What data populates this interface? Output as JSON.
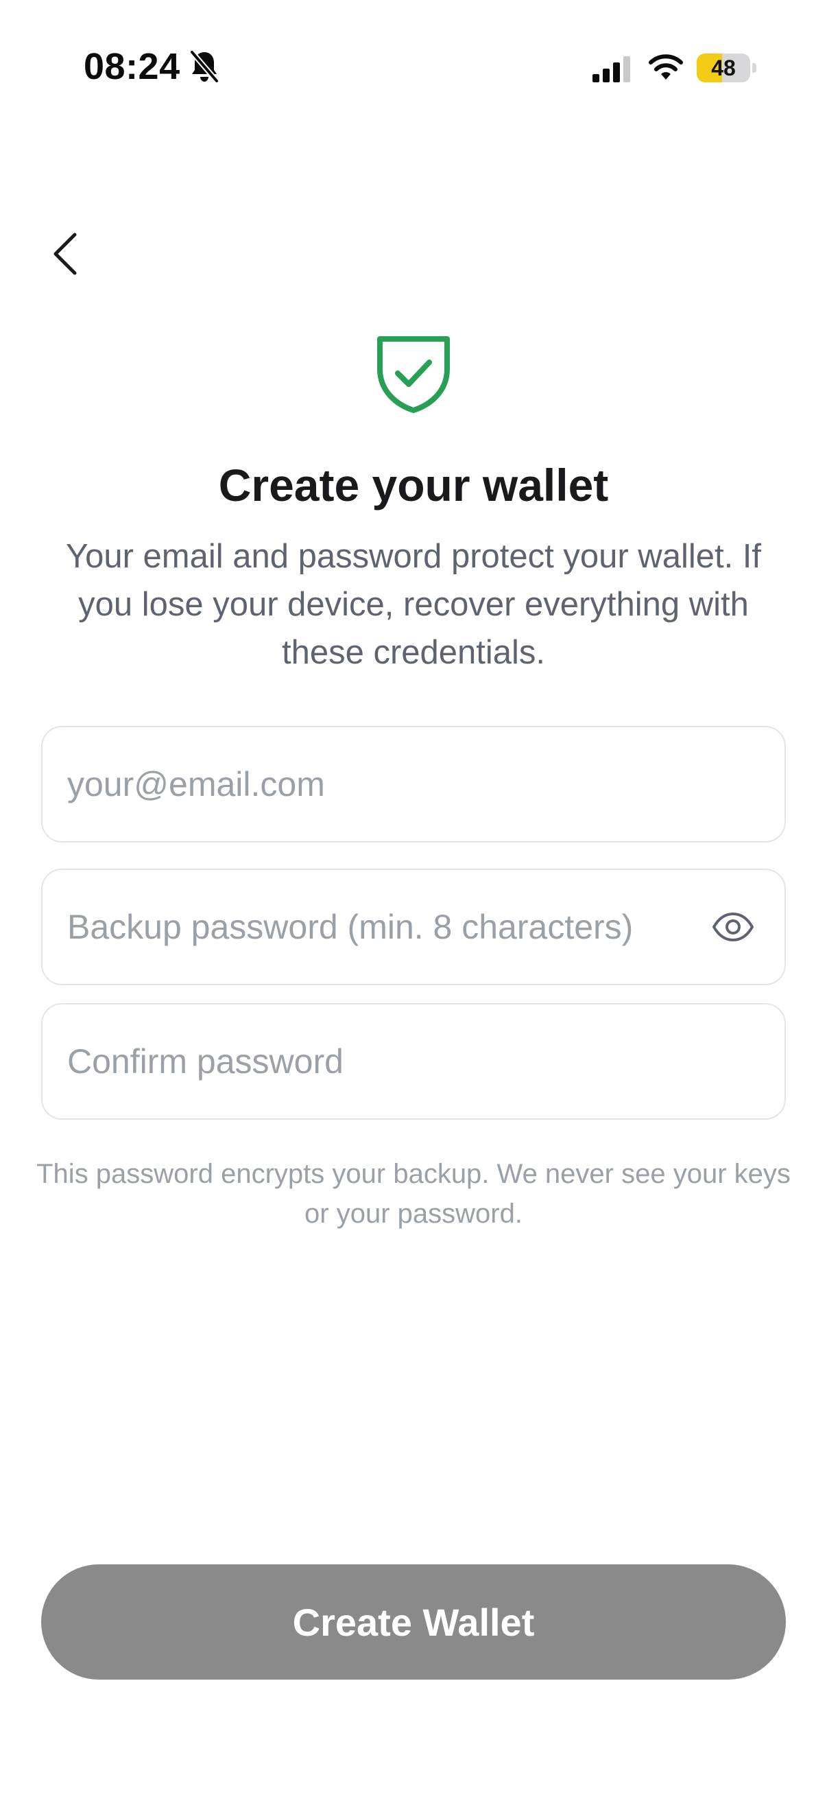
{
  "status_bar": {
    "time": "08:24",
    "battery_level": 48,
    "battery_label": "48",
    "icons": [
      "bell-slash-icon",
      "cellular-signal-icon",
      "wifi-icon",
      "battery-icon"
    ],
    "battery_color": "#f2cc14"
  },
  "header": {
    "back_icon": "chevron-left-icon"
  },
  "hero": {
    "icon": "shield-check-icon",
    "icon_color": "#27a055",
    "title": "Create your wallet",
    "subtitle": "Your email and password protect your wallet. If you lose your device, recover everything with these credentials."
  },
  "form": {
    "email": {
      "value": "",
      "placeholder": "your@email.com"
    },
    "password": {
      "value": "",
      "placeholder": "Backup password (min. 8 characters)",
      "toggle_icon": "eye-icon"
    },
    "confirm_password": {
      "value": "",
      "placeholder": "Confirm password"
    },
    "helper_text": "This password encrypts your backup. We never see your keys or your password."
  },
  "actions": {
    "create_label": "Create Wallet",
    "create_button_color": "#8a8a8a"
  }
}
